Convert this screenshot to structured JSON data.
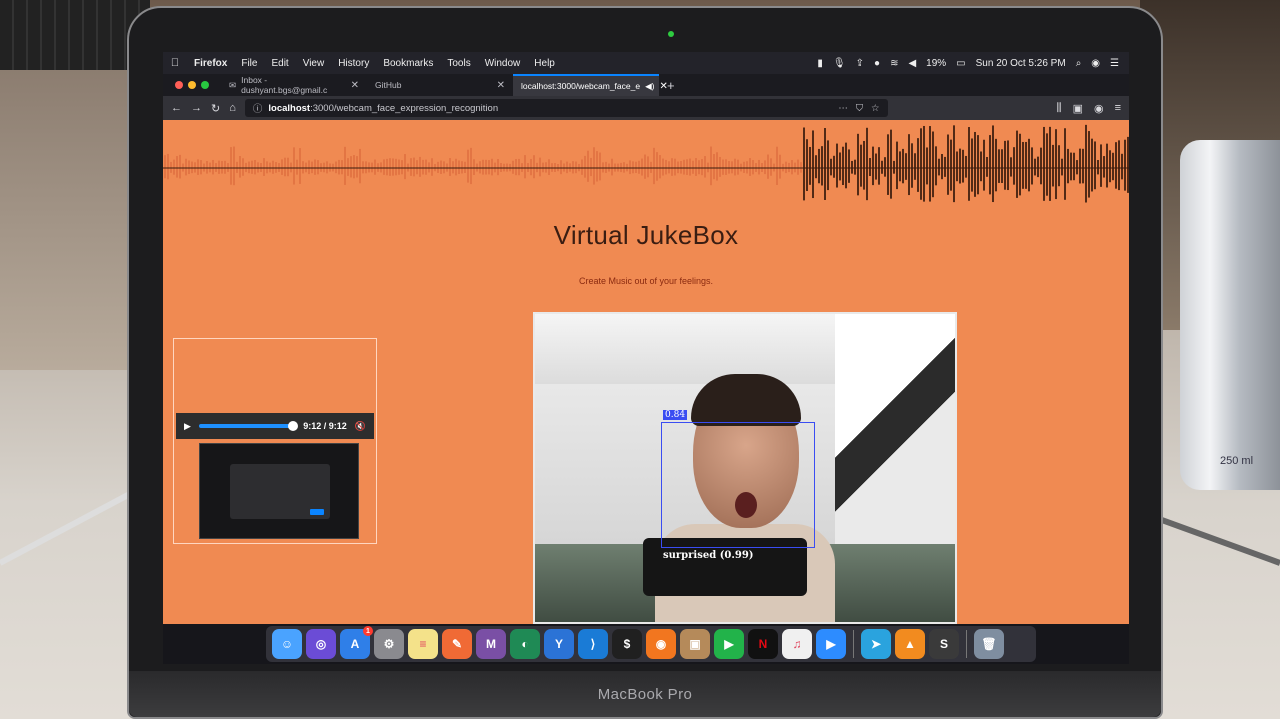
{
  "menubar": {
    "items": [
      "Firefox",
      "File",
      "Edit",
      "View",
      "History",
      "Bookmarks",
      "Tools",
      "Window",
      "Help"
    ],
    "battery": "19%",
    "datetime": "Sun 20 Oct  5:26 PM"
  },
  "browser": {
    "tabs": [
      {
        "label": "Inbox - dushyant.bgs@gmail.c",
        "active": false
      },
      {
        "label": "GitHub",
        "active": false
      },
      {
        "label": "localhost:3000/webcam_face_e",
        "active": true
      }
    ],
    "url_host": "localhost",
    "url_path": ":3000/webcam_face_expression_recognition"
  },
  "page": {
    "title": "Virtual JukeBox",
    "subtitle": "Create Music out of your feelings."
  },
  "webcam": {
    "detection_score": "0.84",
    "expression_label": "surprised (0.99)"
  },
  "video_player": {
    "time": "9:12",
    "duration": "/ 9:12",
    "progress": 1.0
  },
  "dock": {
    "icons": [
      "finder-icon",
      "siri-icon",
      "app-store-icon",
      "system-preferences-icon",
      "notes-icon",
      "postman-icon",
      "mqtt-icon",
      "mongodb-compass-icon",
      "sourcetree-icon",
      "vscode-icon",
      "terminal-icon",
      "firefox-icon",
      "contacts-icon",
      "play-icon",
      "netflix-icon",
      "itunes-icon",
      "zoom-icon",
      "telegram-icon",
      "vlc-icon",
      "sublime-icon",
      "trash-icon"
    ],
    "app_store_badge": "1"
  },
  "device": {
    "model": "MacBook Pro",
    "can_volume": "250 ml"
  }
}
